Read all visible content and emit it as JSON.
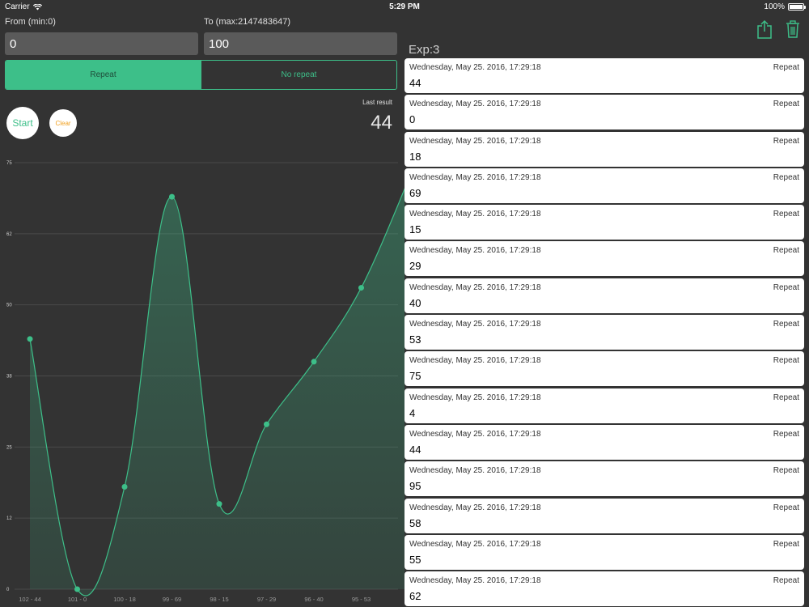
{
  "status_bar": {
    "carrier": "Carrier",
    "time": "5:29 PM",
    "battery": "100%"
  },
  "form": {
    "from_label": "From (min:0)",
    "from_value": "0",
    "to_label": "To (max:2147483647)",
    "to_value": "100"
  },
  "mode_toggle": {
    "repeat_label": "Repeat",
    "no_repeat_label": "No repeat",
    "selected": "Repeat"
  },
  "controls": {
    "start_label": "Start",
    "clear_label": "Clear"
  },
  "last_result": {
    "label": "Last result",
    "value": "44"
  },
  "experiment": {
    "label": "Exp:3"
  },
  "colors": {
    "accent": "#3dbf89",
    "background": "#333333",
    "clear": "#f0a020"
  },
  "icons": [
    "share-icon",
    "trash-icon",
    "wifi-icon",
    "battery-icon"
  ],
  "chart_data": {
    "type": "area",
    "y_ticks": [
      "0",
      "12",
      "25",
      "38",
      "50",
      "62",
      "75"
    ],
    "ylim": [
      0,
      75
    ],
    "x_labels": [
      "102 - 44",
      "101 - 0",
      "100 - 18",
      "99 - 69",
      "98 - 15",
      "97 - 29",
      "96 - 40",
      "95 - 53"
    ],
    "values": [
      44,
      0,
      18,
      69,
      15,
      29,
      40,
      53,
      72
    ],
    "grid": true
  },
  "results": [
    {
      "date": "Wednesday, May 25. 2016, 17:29:18",
      "mode": "Repeat",
      "value": "44"
    },
    {
      "date": "Wednesday, May 25. 2016, 17:29:18",
      "mode": "Repeat",
      "value": "0"
    },
    {
      "date": "Wednesday, May 25. 2016, 17:29:18",
      "mode": "Repeat",
      "value": "18"
    },
    {
      "date": "Wednesday, May 25. 2016, 17:29:18",
      "mode": "Repeat",
      "value": "69"
    },
    {
      "date": "Wednesday, May 25. 2016, 17:29:18",
      "mode": "Repeat",
      "value": "15"
    },
    {
      "date": "Wednesday, May 25. 2016, 17:29:18",
      "mode": "Repeat",
      "value": "29"
    },
    {
      "date": "Wednesday, May 25. 2016, 17:29:18",
      "mode": "Repeat",
      "value": "40"
    },
    {
      "date": "Wednesday, May 25. 2016, 17:29:18",
      "mode": "Repeat",
      "value": "53"
    },
    {
      "date": "Wednesday, May 25. 2016, 17:29:18",
      "mode": "Repeat",
      "value": "75"
    },
    {
      "date": "Wednesday, May 25. 2016, 17:29:18",
      "mode": "Repeat",
      "value": "4"
    },
    {
      "date": "Wednesday, May 25. 2016, 17:29:18",
      "mode": "Repeat",
      "value": "44"
    },
    {
      "date": "Wednesday, May 25. 2016, 17:29:18",
      "mode": "Repeat",
      "value": "95"
    },
    {
      "date": "Wednesday, May 25. 2016, 17:29:18",
      "mode": "Repeat",
      "value": "58"
    },
    {
      "date": "Wednesday, May 25. 2016, 17:29:18",
      "mode": "Repeat",
      "value": "55"
    },
    {
      "date": "Wednesday, May 25. 2016, 17:29:18",
      "mode": "Repeat",
      "value": "62"
    }
  ]
}
